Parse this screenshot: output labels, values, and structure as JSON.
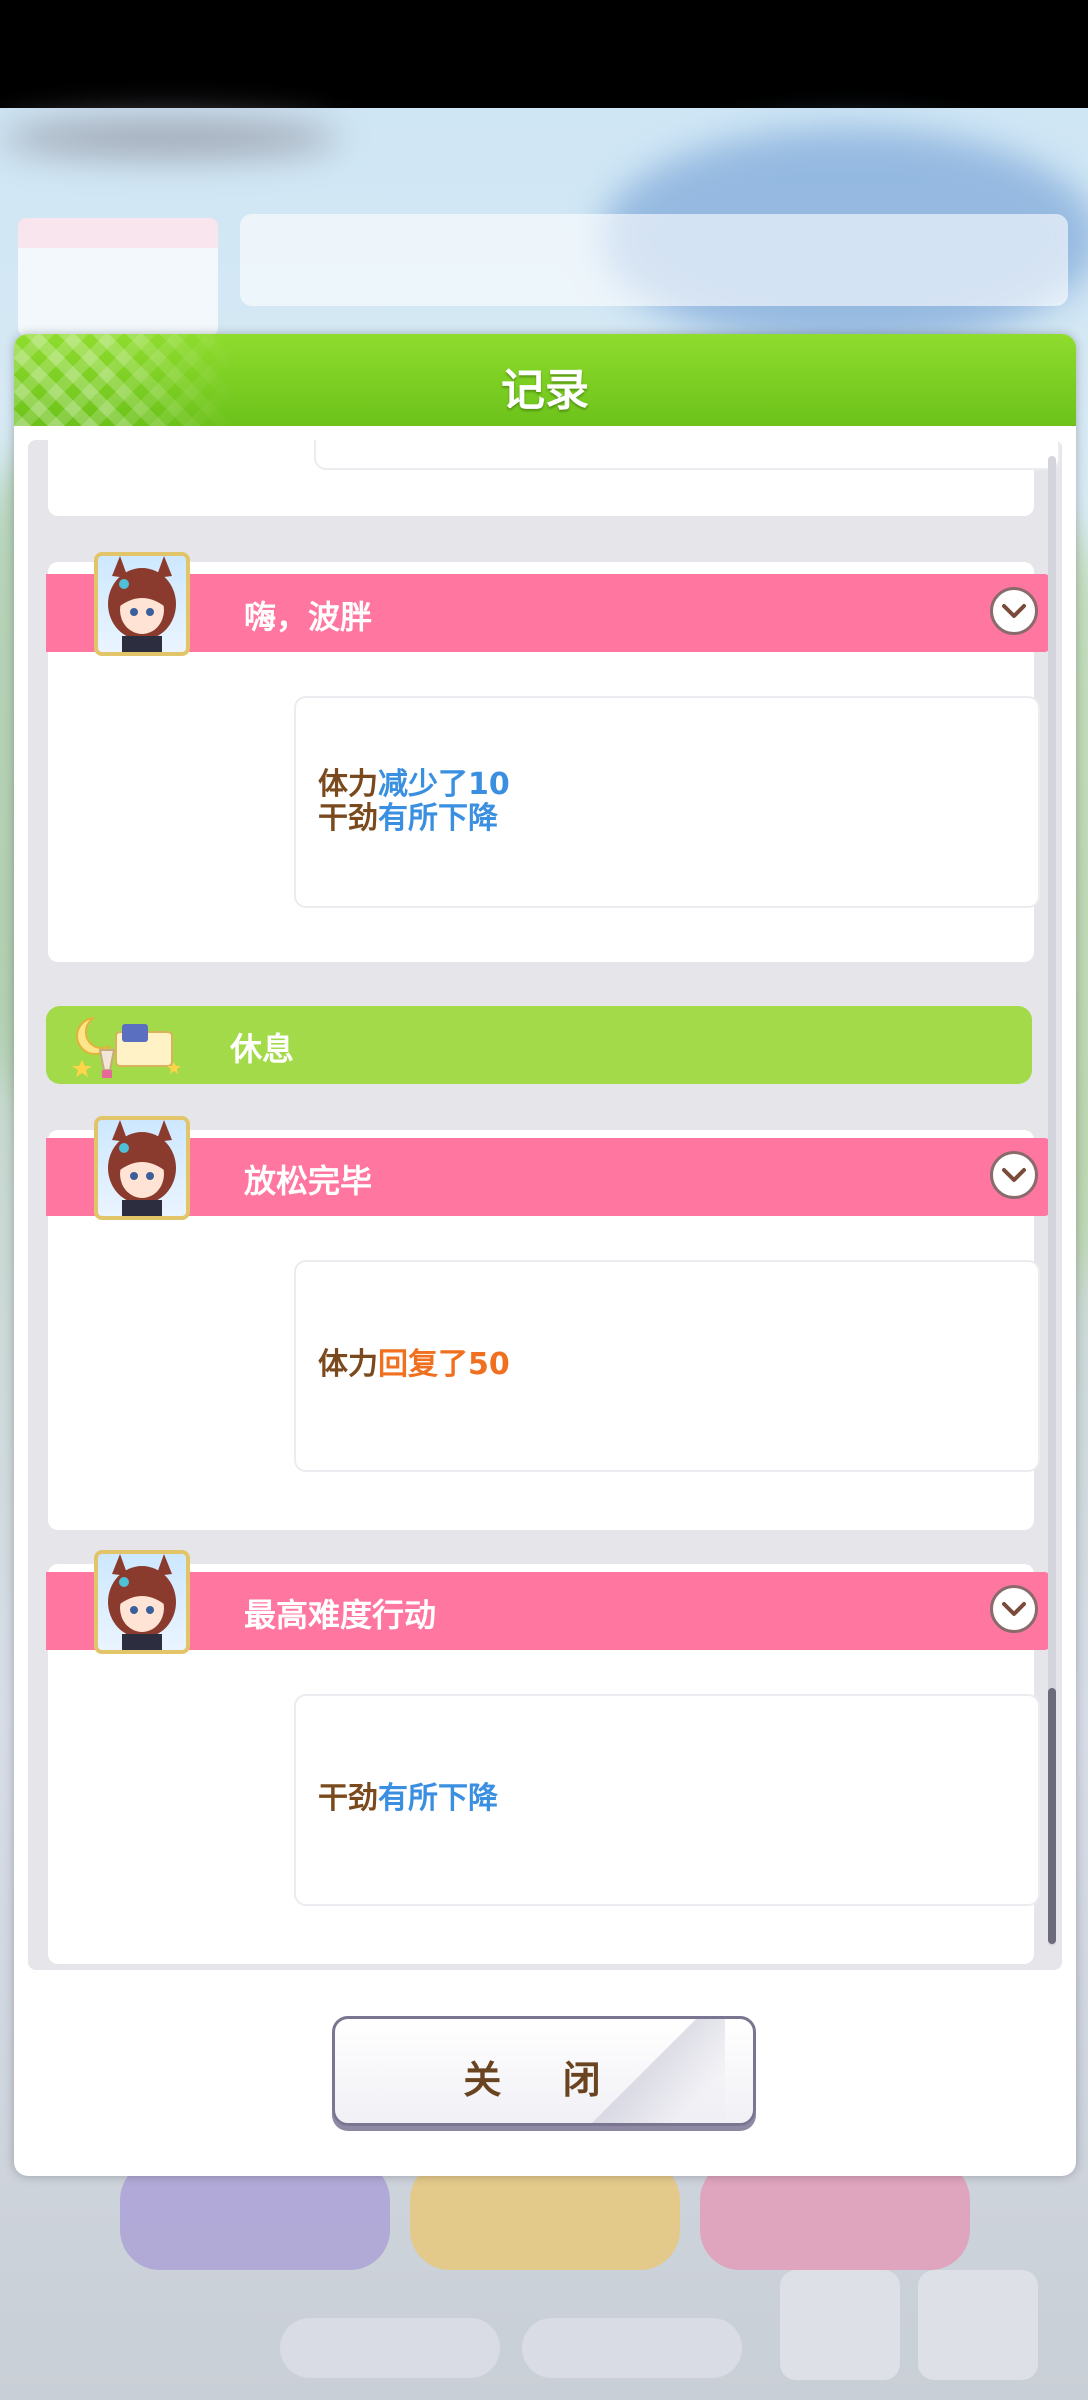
{
  "panel": {
    "title": "记录",
    "close_label": "关 闭"
  },
  "entries": [
    {
      "type": "event",
      "title": "嗨，波胖",
      "lines": [
        {
          "label": "体力",
          "value": "减少了10",
          "color": "#3a8fe0"
        },
        {
          "label": "干劲",
          "value": "有所下降",
          "color": "#3a8fe0"
        }
      ]
    },
    {
      "type": "section",
      "title": "休息",
      "icon": "moon-lamp-bed-icon"
    },
    {
      "type": "event",
      "title": "放松完毕",
      "lines": [
        {
          "label": "体力",
          "value": "回复了50",
          "color": "#f07020"
        }
      ]
    },
    {
      "type": "event",
      "title": "最高难度行动",
      "lines": [
        {
          "label": "干劲",
          "value": "有所下降",
          "color": "#3a8fe0"
        }
      ]
    }
  ],
  "colors": {
    "header_green": "#6cc21a",
    "event_pink": "#ff77a0",
    "section_green": "#a3da4a",
    "label_brown": "#7a4a1e"
  }
}
